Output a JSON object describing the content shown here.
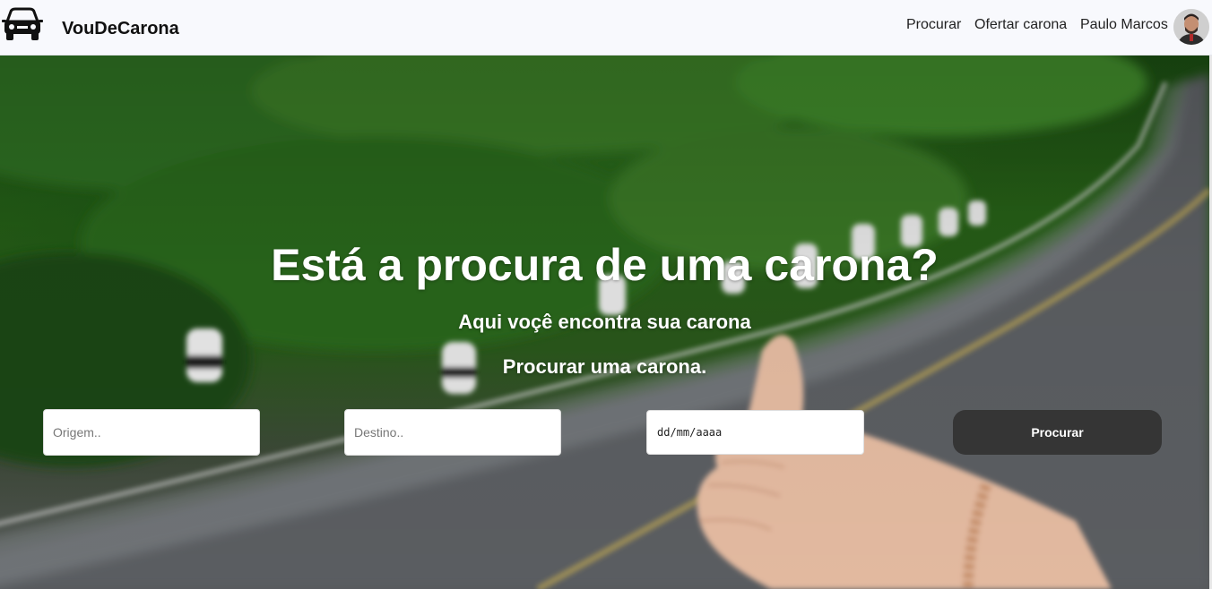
{
  "navbar": {
    "brand": "VouDeCarona",
    "brand_icon": "car-icon",
    "links": [
      "Procurar",
      "Ofertar carona"
    ],
    "user_name": "Paulo Marcos",
    "avatar_icon": "user-avatar"
  },
  "hero": {
    "title": "Está a procura de uma carona?",
    "subtitle": "Aqui voçê encontra sua carona",
    "cta_text": "Procurar uma carona.",
    "origin_placeholder": "Origem..",
    "destination_placeholder": "Destino..",
    "date_placeholder": "dd/mm/aaaa",
    "search_button": "Procurar"
  },
  "colors": {
    "navbar_bg": "#f8f9fd",
    "button_bg": "#353535",
    "text_white": "#ffffff"
  }
}
